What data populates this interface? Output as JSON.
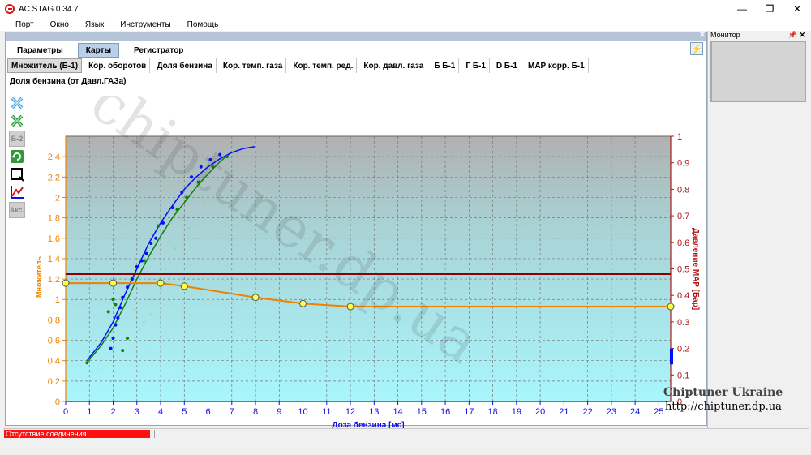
{
  "window": {
    "title": "AC STAG 0.34.7",
    "minimize": "—",
    "maximize": "❐",
    "close": "✕"
  },
  "menu": [
    "Порт",
    "Окно",
    "Язык",
    "Инструменты",
    "Помощь"
  ],
  "tabs_main": [
    {
      "label": "Параметры",
      "active": false
    },
    {
      "label": "Карты",
      "active": true
    },
    {
      "label": "Регистратор",
      "active": false
    }
  ],
  "tabs_maps": [
    "Множитель (Б-1)",
    "Кор. оборотов",
    "Доля бензина",
    "Кор. темп. газа",
    "Кор. темп. ред.",
    "Кор. давл. газа",
    "Б Б-1",
    "Г Б-1",
    "D Б-1",
    "MAP корр. Б-1"
  ],
  "subtitle": "Доля бензина (от Давл.ГАЗа)",
  "toolbar": {
    "b2": "Б-2",
    "aks": "Акс."
  },
  "monitor": {
    "title": "Монитор",
    "pin": "ᵒ",
    "close": "✕"
  },
  "status": {
    "message": "Отсутствие соединения"
  },
  "watermark": {
    "brand": "Chiptuner Ukraine",
    "url": "http://chiptuner.dp.ua",
    "diagonal": "chiptuner.dp.ua"
  },
  "colors": {
    "left_axis": "#f08000",
    "right_axis": "#b01818",
    "x_axis": "#1010e0",
    "multiplier_line": "#f08000",
    "map_line": "#8b0000",
    "blue_curve": "#0010ff",
    "green_curve": "#108010"
  },
  "chart_data": {
    "type": "line",
    "xlabel": "Доза бензина [мс]",
    "ylabel_left": "Множитель",
    "ylabel_right": "Давление MAP [Бар]",
    "x_ticks": [
      "0",
      "1",
      "2",
      "3",
      "4",
      "5",
      "6",
      "7",
      "8",
      "9",
      "10",
      "11",
      "12",
      "13",
      "14",
      "15",
      "16",
      "17",
      "18",
      "19",
      "20",
      "21",
      "22",
      "23",
      "24",
      "25"
    ],
    "y_left_ticks": [
      "0",
      "0.2",
      "0.4",
      "0.6",
      "0.8",
      "1",
      "1.2",
      "1.4",
      "1.6",
      "1.8",
      "2",
      "2.2",
      "2.4"
    ],
    "y_right_ticks": [
      "0",
      "0.1",
      "0.2",
      "0.3",
      "0.4",
      "0.5",
      "0.6",
      "0.7",
      "0.8",
      "0.9",
      "1"
    ],
    "xlim": [
      0,
      25.5
    ],
    "ylim_left": [
      0,
      2.6
    ],
    "ylim_right": [
      0,
      1
    ],
    "grid": true,
    "multiplier_points": [
      {
        "x": 0,
        "y": 1.16
      },
      {
        "x": 2,
        "y": 1.16
      },
      {
        "x": 4,
        "y": 1.16
      },
      {
        "x": 5,
        "y": 1.13
      },
      {
        "x": 8,
        "y": 1.02
      },
      {
        "x": 10,
        "y": 0.96
      },
      {
        "x": 12,
        "y": 0.93
      },
      {
        "x": 25.5,
        "y": 0.93
      }
    ],
    "map_pressure_level": 0.48,
    "blue_curve": [
      {
        "x": 0.9,
        "y": 0.4
      },
      {
        "x": 1.5,
        "y": 0.58
      },
      {
        "x": 2,
        "y": 0.78
      },
      {
        "x": 2.5,
        "y": 1.05
      },
      {
        "x": 3,
        "y": 1.3
      },
      {
        "x": 3.5,
        "y": 1.55
      },
      {
        "x": 4,
        "y": 1.75
      },
      {
        "x": 4.5,
        "y": 1.92
      },
      {
        "x": 5,
        "y": 2.08
      },
      {
        "x": 5.5,
        "y": 2.2
      },
      {
        "x": 6,
        "y": 2.3
      },
      {
        "x": 6.5,
        "y": 2.38
      },
      {
        "x": 7,
        "y": 2.44
      },
      {
        "x": 7.5,
        "y": 2.48
      },
      {
        "x": 8,
        "y": 2.5
      }
    ],
    "green_curve": [
      {
        "x": 0.9,
        "y": 0.38
      },
      {
        "x": 1.5,
        "y": 0.55
      },
      {
        "x": 2,
        "y": 0.72
      },
      {
        "x": 2.5,
        "y": 0.95
      },
      {
        "x": 3,
        "y": 1.2
      },
      {
        "x": 3.5,
        "y": 1.42
      },
      {
        "x": 4,
        "y": 1.62
      },
      {
        "x": 4.5,
        "y": 1.8
      },
      {
        "x": 5,
        "y": 1.95
      },
      {
        "x": 5.5,
        "y": 2.1
      },
      {
        "x": 6,
        "y": 2.23
      },
      {
        "x": 6.5,
        "y": 2.35
      },
      {
        "x": 7,
        "y": 2.45
      }
    ],
    "blue_scatter": [
      {
        "x": 1.9,
        "y": 0.52
      },
      {
        "x": 2.0,
        "y": 0.62
      },
      {
        "x": 2.1,
        "y": 0.75
      },
      {
        "x": 2.2,
        "y": 0.82
      },
      {
        "x": 2.4,
        "y": 1.02
      },
      {
        "x": 2.6,
        "y": 1.12
      },
      {
        "x": 2.8,
        "y": 1.2
      },
      {
        "x": 3.0,
        "y": 1.32
      },
      {
        "x": 3.2,
        "y": 1.38
      },
      {
        "x": 3.6,
        "y": 1.55
      },
      {
        "x": 3.8,
        "y": 1.6
      },
      {
        "x": 4.1,
        "y": 1.75
      },
      {
        "x": 4.5,
        "y": 1.9
      },
      {
        "x": 4.9,
        "y": 2.05
      },
      {
        "x": 5.3,
        "y": 2.2
      },
      {
        "x": 5.7,
        "y": 2.3
      },
      {
        "x": 6.1,
        "y": 2.37
      },
      {
        "x": 6.5,
        "y": 2.42
      },
      {
        "x": 3.4,
        "y": 1.45
      },
      {
        "x": 2.3,
        "y": 0.92
      }
    ],
    "green_scatter": [
      {
        "x": 0.9,
        "y": 0.38
      },
      {
        "x": 1.8,
        "y": 0.88
      },
      {
        "x": 2.1,
        "y": 0.95
      },
      {
        "x": 2.4,
        "y": 0.5
      },
      {
        "x": 2.6,
        "y": 0.62
      },
      {
        "x": 2.9,
        "y": 1.25
      },
      {
        "x": 3.3,
        "y": 1.38
      },
      {
        "x": 3.9,
        "y": 1.72
      },
      {
        "x": 4.7,
        "y": 1.88
      },
      {
        "x": 5.1,
        "y": 2.0
      },
      {
        "x": 5.6,
        "y": 2.15
      },
      {
        "x": 6.2,
        "y": 2.3
      },
      {
        "x": 6.8,
        "y": 2.4
      },
      {
        "x": 2.0,
        "y": 1.0
      }
    ],
    "faint_scatter": [
      {
        "x": 3.1,
        "y": 0.7
      },
      {
        "x": 3.3,
        "y": 0.78
      },
      {
        "x": 3.6,
        "y": 0.85
      },
      {
        "x": 4.2,
        "y": 1.3
      },
      {
        "x": 4.6,
        "y": 1.5
      },
      {
        "x": 5.2,
        "y": 1.7
      },
      {
        "x": 5.8,
        "y": 1.95
      },
      {
        "x": 6.4,
        "y": 2.1
      },
      {
        "x": 7.2,
        "y": 2.3
      },
      {
        "x": 7.6,
        "y": 2.4
      },
      {
        "x": 4.0,
        "y": 2.2
      },
      {
        "x": 5.6,
        "y": 2.45
      },
      {
        "x": 1.5,
        "y": 0.3
      },
      {
        "x": 2.9,
        "y": 0.9
      }
    ],
    "indicator_bar": {
      "x": 25.5,
      "y_right_from": 0.14,
      "y_right_to": 0.2
    }
  }
}
